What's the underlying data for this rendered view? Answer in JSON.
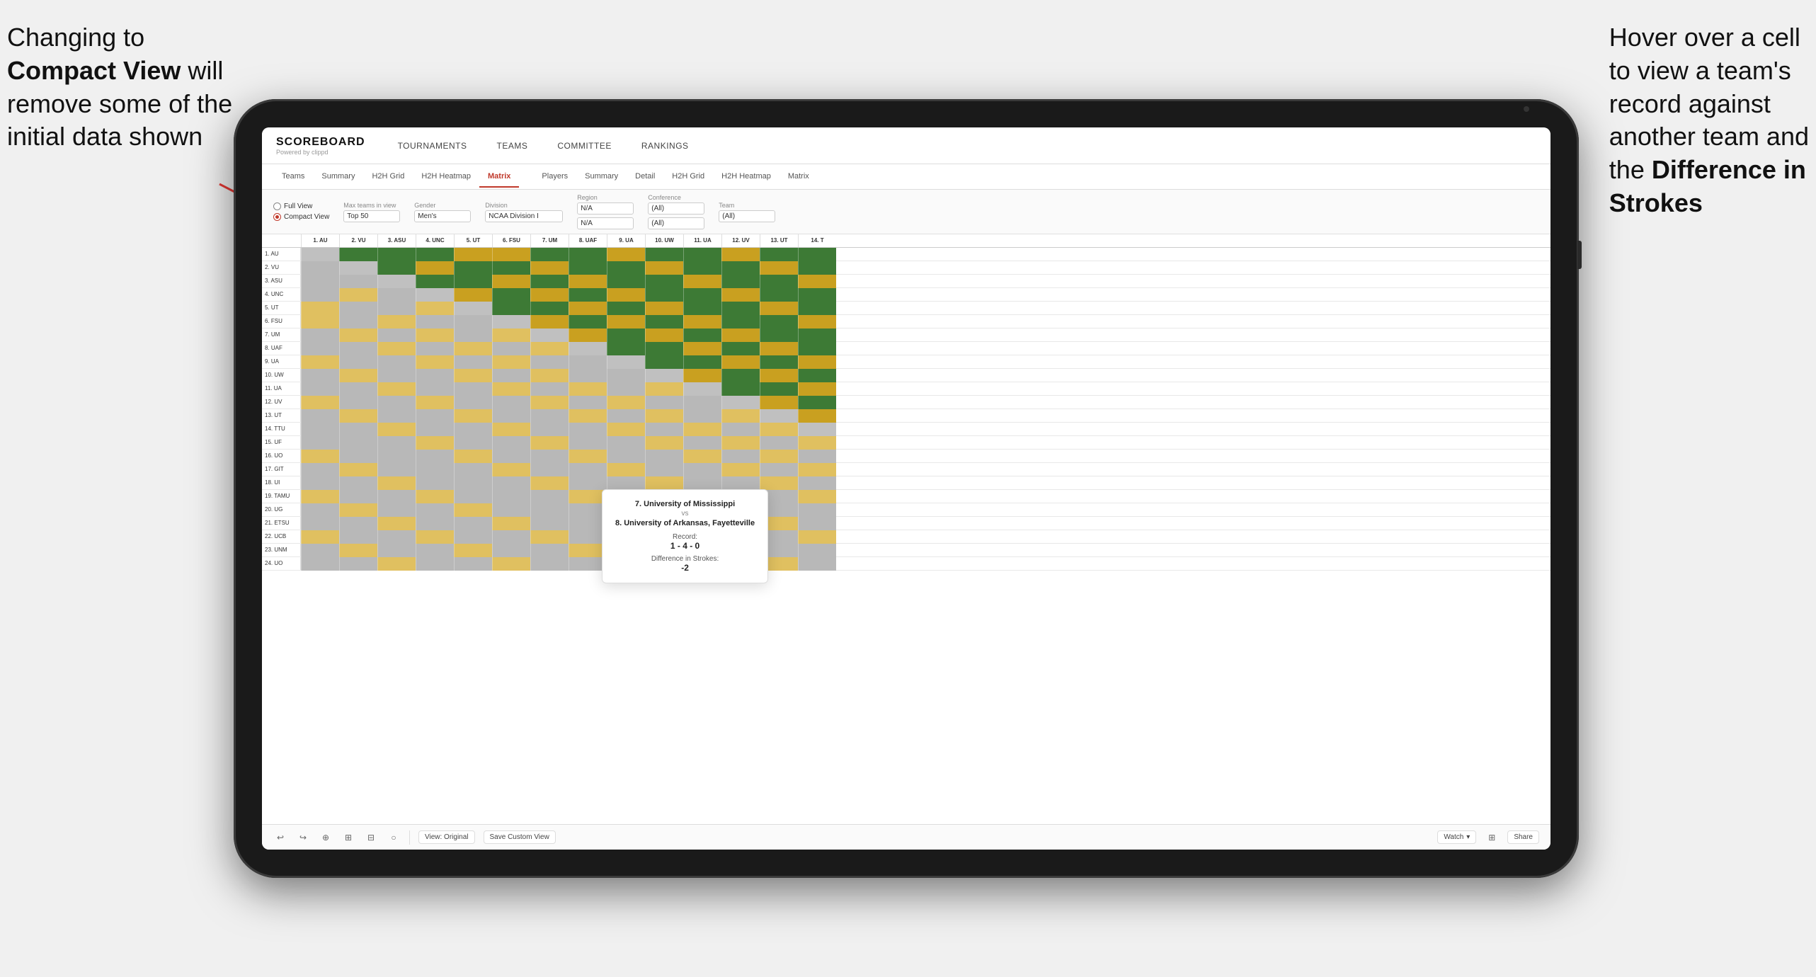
{
  "annotations": {
    "left_text_line1": "Changing to",
    "left_text_bold": "Compact View",
    "left_text_line2": " will",
    "left_text_line3": "remove some of the",
    "left_text_line4": "initial data shown",
    "right_text_line1": "Hover over a cell",
    "right_text_line2": "to view a team's",
    "right_text_line3": "record against",
    "right_text_line4": "another team and",
    "right_text_line5": "the ",
    "right_text_bold": "Difference in",
    "right_text_line6": "Strokes"
  },
  "nav": {
    "logo": "SCOREBOARD",
    "logo_sub": "Powered by clippd",
    "items": [
      "TOURNAMENTS",
      "TEAMS",
      "COMMITTEE",
      "RANKINGS"
    ]
  },
  "sub_tabs": {
    "group1": [
      "Teams",
      "Summary",
      "H2H Grid",
      "H2H Heatmap",
      "Matrix"
    ],
    "group2": [
      "Players",
      "Summary",
      "Detail",
      "H2H Grid",
      "H2H Heatmap",
      "Matrix"
    ],
    "active": "Matrix"
  },
  "filters": {
    "view_options": [
      "Full View",
      "Compact View"
    ],
    "selected_view": "Compact View",
    "max_teams_label": "Max teams in view",
    "max_teams_value": "Top 50",
    "gender_label": "Gender",
    "gender_value": "Men's",
    "division_label": "Division",
    "division_value": "NCAA Division I",
    "region_label": "Region",
    "region_value": "N/A",
    "conference_label": "Conference",
    "conference_value": "(All)",
    "team_label": "Team",
    "team_value": "(All)"
  },
  "matrix": {
    "col_headers": [
      "1. AU",
      "2. VU",
      "3. ASU",
      "4. UNC",
      "5. UT",
      "6. FSU",
      "7. UM",
      "8. UAF",
      "9. UA",
      "10. UW",
      "11. UA",
      "12. UV",
      "13. UT",
      "14. T"
    ],
    "rows": [
      {
        "label": "1. AU",
        "cells": [
          "empty",
          "green",
          "green",
          "green",
          "yellow",
          "yellow",
          "green",
          "green",
          "yellow",
          "green",
          "green",
          "yellow",
          "green",
          "green"
        ]
      },
      {
        "label": "2. VU",
        "cells": [
          "lgray",
          "empty",
          "green",
          "yellow",
          "green",
          "green",
          "yellow",
          "green",
          "green",
          "yellow",
          "green",
          "green",
          "yellow",
          "green"
        ]
      },
      {
        "label": "3. ASU",
        "cells": [
          "lgray",
          "lgray",
          "empty",
          "green",
          "green",
          "yellow",
          "green",
          "yellow",
          "green",
          "green",
          "yellow",
          "green",
          "green",
          "yellow"
        ]
      },
      {
        "label": "4. UNC",
        "cells": [
          "lgray",
          "lyellow",
          "lgray",
          "empty",
          "yellow",
          "green",
          "yellow",
          "green",
          "yellow",
          "green",
          "green",
          "yellow",
          "green",
          "green"
        ]
      },
      {
        "label": "5. UT",
        "cells": [
          "lyellow",
          "lgray",
          "lgray",
          "lyellow",
          "empty",
          "green",
          "green",
          "yellow",
          "green",
          "yellow",
          "green",
          "green",
          "yellow",
          "green"
        ]
      },
      {
        "label": "6. FSU",
        "cells": [
          "lyellow",
          "lgray",
          "lyellow",
          "lgray",
          "lgray",
          "empty",
          "yellow",
          "green",
          "yellow",
          "green",
          "yellow",
          "green",
          "green",
          "yellow"
        ]
      },
      {
        "label": "7. UM",
        "cells": [
          "lgray",
          "lyellow",
          "lgray",
          "lyellow",
          "lgray",
          "lyellow",
          "empty",
          "yellow",
          "green",
          "yellow",
          "green",
          "yellow",
          "green",
          "green"
        ]
      },
      {
        "label": "8. UAF",
        "cells": [
          "lgray",
          "lgray",
          "lyellow",
          "lgray",
          "lyellow",
          "lgray",
          "lyellow",
          "empty",
          "green",
          "green",
          "yellow",
          "green",
          "yellow",
          "green"
        ]
      },
      {
        "label": "9. UA",
        "cells": [
          "lyellow",
          "lgray",
          "lgray",
          "lyellow",
          "lgray",
          "lyellow",
          "lgray",
          "lgray",
          "empty",
          "green",
          "green",
          "yellow",
          "green",
          "yellow"
        ]
      },
      {
        "label": "10. UW",
        "cells": [
          "lgray",
          "lyellow",
          "lgray",
          "lgray",
          "lyellow",
          "lgray",
          "lyellow",
          "lgray",
          "lgray",
          "empty",
          "yellow",
          "green",
          "yellow",
          "green"
        ]
      },
      {
        "label": "11. UA",
        "cells": [
          "lgray",
          "lgray",
          "lyellow",
          "lgray",
          "lgray",
          "lyellow",
          "lgray",
          "lyellow",
          "lgray",
          "lyellow",
          "empty",
          "green",
          "green",
          "yellow"
        ]
      },
      {
        "label": "12. UV",
        "cells": [
          "lyellow",
          "lgray",
          "lgray",
          "lyellow",
          "lgray",
          "lgray",
          "lyellow",
          "lgray",
          "lyellow",
          "lgray",
          "lgray",
          "empty",
          "yellow",
          "green"
        ]
      },
      {
        "label": "13. UT",
        "cells": [
          "lgray",
          "lyellow",
          "lgray",
          "lgray",
          "lyellow",
          "lgray",
          "lgray",
          "lyellow",
          "lgray",
          "lyellow",
          "lgray",
          "lyellow",
          "empty",
          "yellow"
        ]
      },
      {
        "label": "14. TTU",
        "cells": [
          "lgray",
          "lgray",
          "lyellow",
          "lgray",
          "lgray",
          "lyellow",
          "lgray",
          "lgray",
          "lyellow",
          "lgray",
          "lyellow",
          "lgray",
          "lyellow",
          "empty"
        ]
      },
      {
        "label": "15. UF",
        "cells": [
          "lgray",
          "lgray",
          "lgray",
          "lyellow",
          "lgray",
          "lgray",
          "lyellow",
          "lgray",
          "lgray",
          "lyellow",
          "lgray",
          "lyellow",
          "lgray",
          "lyellow"
        ]
      },
      {
        "label": "16. UO",
        "cells": [
          "lyellow",
          "lgray",
          "lgray",
          "lgray",
          "lyellow",
          "lgray",
          "lgray",
          "lyellow",
          "lgray",
          "lgray",
          "lyellow",
          "lgray",
          "lyellow",
          "lgray"
        ]
      },
      {
        "label": "17. GIT",
        "cells": [
          "lgray",
          "lyellow",
          "lgray",
          "lgray",
          "lgray",
          "lyellow",
          "lgray",
          "lgray",
          "lyellow",
          "lgray",
          "lgray",
          "lyellow",
          "lgray",
          "lyellow"
        ]
      },
      {
        "label": "18. UI",
        "cells": [
          "lgray",
          "lgray",
          "lyellow",
          "lgray",
          "lgray",
          "lgray",
          "lyellow",
          "lgray",
          "lgray",
          "lyellow",
          "lgray",
          "lgray",
          "lyellow",
          "lgray"
        ]
      },
      {
        "label": "19. TAMU",
        "cells": [
          "lyellow",
          "lgray",
          "lgray",
          "lyellow",
          "lgray",
          "lgray",
          "lgray",
          "lyellow",
          "lgray",
          "lgray",
          "lyellow",
          "lgray",
          "lgray",
          "lyellow"
        ]
      },
      {
        "label": "20. UG",
        "cells": [
          "lgray",
          "lyellow",
          "lgray",
          "lgray",
          "lyellow",
          "lgray",
          "lgray",
          "lgray",
          "lyellow",
          "lgray",
          "lgray",
          "lyellow",
          "lgray",
          "lgray"
        ]
      },
      {
        "label": "21. ETSU",
        "cells": [
          "lgray",
          "lgray",
          "lyellow",
          "lgray",
          "lgray",
          "lyellow",
          "lgray",
          "lgray",
          "lgray",
          "lyellow",
          "lgray",
          "lgray",
          "lyellow",
          "lgray"
        ]
      },
      {
        "label": "22. UCB",
        "cells": [
          "lyellow",
          "lgray",
          "lgray",
          "lyellow",
          "lgray",
          "lgray",
          "lyellow",
          "lgray",
          "lgray",
          "lgray",
          "lyellow",
          "lgray",
          "lgray",
          "lyellow"
        ]
      },
      {
        "label": "23. UNM",
        "cells": [
          "lgray",
          "lyellow",
          "lgray",
          "lgray",
          "lyellow",
          "lgray",
          "lgray",
          "lyellow",
          "lgray",
          "lgray",
          "lgray",
          "lyellow",
          "lgray",
          "lgray"
        ]
      },
      {
        "label": "24. UO",
        "cells": [
          "lgray",
          "lgray",
          "lyellow",
          "lgray",
          "lgray",
          "lyellow",
          "lgray",
          "lgray",
          "lyellow",
          "lgray",
          "lgray",
          "lgray",
          "lyellow",
          "lgray"
        ]
      }
    ]
  },
  "tooltip": {
    "team1": "7. University of Mississippi",
    "vs": "vs",
    "team2": "8. University of Arkansas, Fayetteville",
    "record_label": "Record:",
    "record_value": "1 - 4 - 0",
    "strokes_label": "Difference in Strokes:",
    "strokes_value": "-2"
  },
  "toolbar": {
    "buttons": [
      "View: Original",
      "Save Custom View",
      "Watch",
      "Share"
    ]
  }
}
